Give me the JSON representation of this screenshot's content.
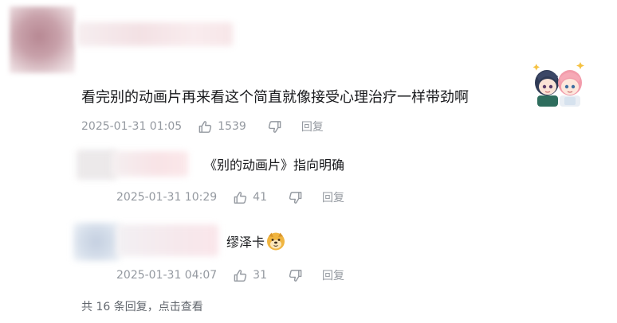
{
  "main_comment": {
    "text": "看完别的动画片再来看这个简直就像接受心理治疗一样带劲啊",
    "sticker": "anime-girls-sticker",
    "time": "2025-01-31 01:05",
    "likes": "1539",
    "reply_label": "回复"
  },
  "replies": [
    {
      "text": "《别的动画片》指向明确",
      "time": "2025-01-31 10:29",
      "likes": "41",
      "reply_label": "回复"
    },
    {
      "text": "缪泽卡",
      "emoji": "doge-emoji",
      "time": "2025-01-31 04:07",
      "likes": "31",
      "reply_label": "回复"
    }
  ],
  "summary": {
    "prefix": "共 16 条回复，",
    "view_more": "点击查看"
  },
  "icons": {
    "like": "thumbs-up-icon",
    "dislike": "thumbs-down-icon"
  },
  "colors": {
    "meta_gray": "#9499a0",
    "text_dark": "#18191c"
  }
}
